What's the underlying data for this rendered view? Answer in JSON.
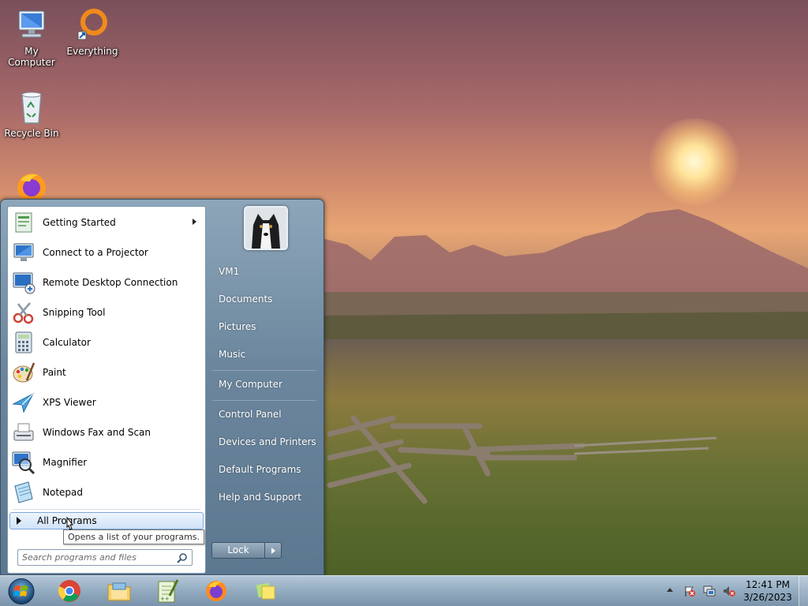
{
  "desktop": {
    "icons": [
      {
        "label": "My Computer",
        "icon": "computer-icon"
      },
      {
        "label": "Everything",
        "icon": "everything-icon"
      },
      {
        "label": "Recycle Bin",
        "icon": "recycle-bin-icon"
      },
      {
        "label": "",
        "icon": "firefox-icon"
      }
    ]
  },
  "start_menu": {
    "programs": [
      {
        "label": "Getting Started",
        "icon": "getting-started-icon",
        "has_submenu": true
      },
      {
        "label": "Connect to a Projector",
        "icon": "projector-icon"
      },
      {
        "label": "Remote Desktop Connection",
        "icon": "remote-desktop-icon"
      },
      {
        "label": "Snipping Tool",
        "icon": "scissors-icon"
      },
      {
        "label": "Calculator",
        "icon": "calculator-icon"
      },
      {
        "label": "Paint",
        "icon": "paint-palette-icon"
      },
      {
        "label": "XPS Viewer",
        "icon": "xps-viewer-icon"
      },
      {
        "label": "Windows Fax and Scan",
        "icon": "fax-scanner-icon"
      },
      {
        "label": "Magnifier",
        "icon": "magnifier-icon"
      },
      {
        "label": "Notepad",
        "icon": "notepad-icon"
      }
    ],
    "all_programs_label": "All Programs",
    "search": {
      "placeholder": "Search programs and files",
      "value": ""
    },
    "user_links": [
      {
        "label": "VM1"
      },
      {
        "label": "Documents"
      },
      {
        "label": "Pictures"
      },
      {
        "label": "Music"
      },
      {
        "label": "My Computer"
      },
      {
        "label": "Control Panel"
      },
      {
        "label": "Devices and Printers"
      },
      {
        "label": "Default Programs"
      },
      {
        "label": "Help and Support"
      }
    ],
    "lock_label": "Lock",
    "tooltip": "Opens a list of your programs."
  },
  "taskbar": {
    "pinned": [
      {
        "name": "chrome-icon"
      },
      {
        "name": "file-explorer-icon"
      },
      {
        "name": "notepad-plus-plus-icon"
      },
      {
        "name": "firefox-icon"
      },
      {
        "name": "sticky-notes-icon"
      }
    ],
    "tray": {
      "icons": [
        "action-center-flag-icon",
        "network-icon",
        "volume-muted-icon"
      ]
    },
    "clock": {
      "time": "12:41 PM",
      "date": "3/26/2023"
    }
  },
  "colors": {
    "start_menu_blue": "#6b869d",
    "taskbar_blue": "#96afc8",
    "highlight": "#cfe3f8"
  }
}
